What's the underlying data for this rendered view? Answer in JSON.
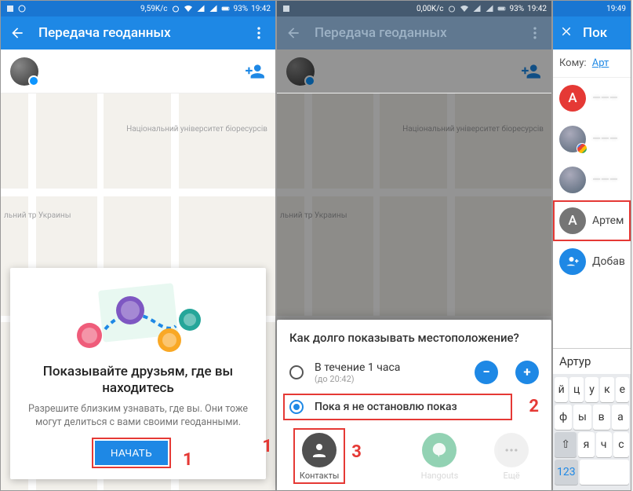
{
  "screen1": {
    "statusbar": {
      "time": "19:42",
      "speed": "9,59K/c",
      "battery": "93%"
    },
    "app_title": "Передача геоданных",
    "map_labels": {
      "university": "Національний\nуніверситет\nбіоресурсів",
      "country": "льний\nтр Украины"
    },
    "card": {
      "headline": "Показывайте друзьям, где вы находитесь",
      "body": "Разрешите близким узнавать, где вы. Они тоже могут делиться с вами своими геоданными.",
      "cta": "НАЧАТЬ"
    },
    "anno": "1"
  },
  "screen2": {
    "statusbar": {
      "time": "19:42",
      "speed": "0,00K/c",
      "battery": "93%"
    },
    "app_title": "Передача геоданных",
    "sheet_title": "Как долго показывать местоположение?",
    "opt1": {
      "main": "В течение 1 часа",
      "sub": "(до 20:42)"
    },
    "opt2": {
      "main": "Пока я не остановлю показ"
    },
    "share": {
      "contacts": "Контакты",
      "hangouts": "Hangouts",
      "more": "Ещё"
    },
    "anno2": "2",
    "anno3": "3"
  },
  "screen3": {
    "statusbar": {
      "time": "19:49"
    },
    "app_title": "Пок",
    "to_label": "Кому:",
    "to_value": "Арт",
    "contacts": [
      {
        "letter": "A"
      },
      {
        "name": "Артем"
      },
      {
        "name": "Добав"
      }
    ],
    "suggestion": "Артур",
    "keys": {
      "r1": [
        "й",
        "ц",
        "у",
        "к",
        "е"
      ],
      "r2": [
        "ф",
        "ы",
        "в",
        "а"
      ],
      "numkey": "123"
    }
  }
}
